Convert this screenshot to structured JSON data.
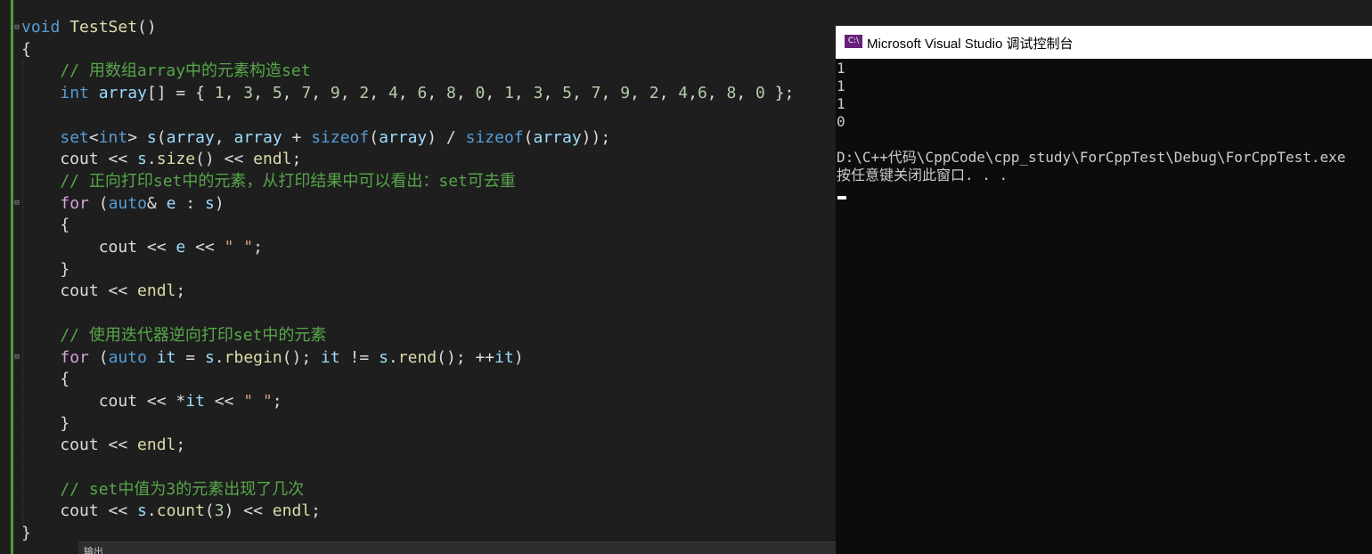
{
  "editor": {
    "lines": [
      [
        {
          "t": "void ",
          "c": "kw"
        },
        {
          "t": "TestSet",
          "c": "fn"
        },
        {
          "t": "()",
          "c": "pl"
        }
      ],
      [
        {
          "t": "{",
          "c": "pl"
        }
      ],
      [
        {
          "t": "    // 用数组array中的元素构造set",
          "c": "cm"
        }
      ],
      [
        {
          "t": "    ",
          "c": "pl"
        },
        {
          "t": "int ",
          "c": "kw"
        },
        {
          "t": "array",
          "c": "vr"
        },
        {
          "t": "[] = { ",
          "c": "pl"
        },
        {
          "t": "1",
          "c": "nm"
        },
        {
          "t": ", ",
          "c": "pl"
        },
        {
          "t": "3",
          "c": "nm"
        },
        {
          "t": ", ",
          "c": "pl"
        },
        {
          "t": "5",
          "c": "nm"
        },
        {
          "t": ", ",
          "c": "pl"
        },
        {
          "t": "7",
          "c": "nm"
        },
        {
          "t": ", ",
          "c": "pl"
        },
        {
          "t": "9",
          "c": "nm"
        },
        {
          "t": ", ",
          "c": "pl"
        },
        {
          "t": "2",
          "c": "nm"
        },
        {
          "t": ", ",
          "c": "pl"
        },
        {
          "t": "4",
          "c": "nm"
        },
        {
          "t": ", ",
          "c": "pl"
        },
        {
          "t": "6",
          "c": "nm"
        },
        {
          "t": ", ",
          "c": "pl"
        },
        {
          "t": "8",
          "c": "nm"
        },
        {
          "t": ", ",
          "c": "pl"
        },
        {
          "t": "0",
          "c": "nm"
        },
        {
          "t": ", ",
          "c": "pl"
        },
        {
          "t": "1",
          "c": "nm"
        },
        {
          "t": ", ",
          "c": "pl"
        },
        {
          "t": "3",
          "c": "nm"
        },
        {
          "t": ", ",
          "c": "pl"
        },
        {
          "t": "5",
          "c": "nm"
        },
        {
          "t": ", ",
          "c": "pl"
        },
        {
          "t": "7",
          "c": "nm"
        },
        {
          "t": ", ",
          "c": "pl"
        },
        {
          "t": "9",
          "c": "nm"
        },
        {
          "t": ", ",
          "c": "pl"
        },
        {
          "t": "2",
          "c": "nm"
        },
        {
          "t": ", ",
          "c": "pl"
        },
        {
          "t": "4",
          "c": "nm"
        },
        {
          "t": ",",
          "c": "pl"
        },
        {
          "t": "6",
          "c": "nm"
        },
        {
          "t": ", ",
          "c": "pl"
        },
        {
          "t": "8",
          "c": "nm"
        },
        {
          "t": ", ",
          "c": "pl"
        },
        {
          "t": "0",
          "c": "nm"
        },
        {
          "t": " };",
          "c": "pl"
        }
      ],
      [],
      [
        {
          "t": "    ",
          "c": "pl"
        },
        {
          "t": "set",
          "c": "kw"
        },
        {
          "t": "<",
          "c": "pl"
        },
        {
          "t": "int",
          "c": "kw"
        },
        {
          "t": "> ",
          "c": "pl"
        },
        {
          "t": "s",
          "c": "vr"
        },
        {
          "t": "(",
          "c": "pl"
        },
        {
          "t": "array",
          "c": "vr"
        },
        {
          "t": ", ",
          "c": "pl"
        },
        {
          "t": "array",
          "c": "vr"
        },
        {
          "t": " + ",
          "c": "pl"
        },
        {
          "t": "sizeof",
          "c": "kw"
        },
        {
          "t": "(",
          "c": "pl"
        },
        {
          "t": "array",
          "c": "vr"
        },
        {
          "t": ") / ",
          "c": "pl"
        },
        {
          "t": "sizeof",
          "c": "kw"
        },
        {
          "t": "(",
          "c": "pl"
        },
        {
          "t": "array",
          "c": "vr"
        },
        {
          "t": "));",
          "c": "pl"
        }
      ],
      [
        {
          "t": "    cout << ",
          "c": "pl"
        },
        {
          "t": "s",
          "c": "vr"
        },
        {
          "t": ".",
          "c": "pl"
        },
        {
          "t": "size",
          "c": "fn"
        },
        {
          "t": "() << ",
          "c": "pl"
        },
        {
          "t": "endl",
          "c": "fn"
        },
        {
          "t": ";",
          "c": "pl"
        }
      ],
      [
        {
          "t": "    // 正向打印set中的元素，从打印结果中可以看出：set可去重",
          "c": "cm"
        }
      ],
      [
        {
          "t": "    ",
          "c": "pl"
        },
        {
          "t": "for",
          "c": "ctl"
        },
        {
          "t": " (",
          "c": "pl"
        },
        {
          "t": "auto",
          "c": "kw"
        },
        {
          "t": "& ",
          "c": "pl"
        },
        {
          "t": "e",
          "c": "vr"
        },
        {
          "t": " : ",
          "c": "pl"
        },
        {
          "t": "s",
          "c": "vr"
        },
        {
          "t": ")",
          "c": "pl"
        }
      ],
      [
        {
          "t": "    {",
          "c": "pl"
        }
      ],
      [
        {
          "t": "        cout << ",
          "c": "pl"
        },
        {
          "t": "e",
          "c": "vr"
        },
        {
          "t": " << ",
          "c": "pl"
        },
        {
          "t": "\" \"",
          "c": "st"
        },
        {
          "t": ";",
          "c": "pl"
        }
      ],
      [
        {
          "t": "    }",
          "c": "pl"
        }
      ],
      [
        {
          "t": "    cout << ",
          "c": "pl"
        },
        {
          "t": "endl",
          "c": "fn"
        },
        {
          "t": ";",
          "c": "pl"
        }
      ],
      [],
      [
        {
          "t": "    // 使用迭代器逆向打印set中的元素",
          "c": "cm"
        }
      ],
      [
        {
          "t": "    ",
          "c": "pl"
        },
        {
          "t": "for",
          "c": "ctl"
        },
        {
          "t": " (",
          "c": "pl"
        },
        {
          "t": "auto ",
          "c": "kw"
        },
        {
          "t": "it",
          "c": "vr"
        },
        {
          "t": " = ",
          "c": "pl"
        },
        {
          "t": "s",
          "c": "vr"
        },
        {
          "t": ".",
          "c": "pl"
        },
        {
          "t": "rbegin",
          "c": "fn"
        },
        {
          "t": "(); ",
          "c": "pl"
        },
        {
          "t": "it",
          "c": "vr"
        },
        {
          "t": " != ",
          "c": "pl"
        },
        {
          "t": "s",
          "c": "vr"
        },
        {
          "t": ".",
          "c": "pl"
        },
        {
          "t": "rend",
          "c": "fn"
        },
        {
          "t": "(); ++",
          "c": "pl"
        },
        {
          "t": "it",
          "c": "vr"
        },
        {
          "t": ")",
          "c": "pl"
        }
      ],
      [
        {
          "t": "    {",
          "c": "pl"
        }
      ],
      [
        {
          "t": "        cout << *",
          "c": "pl"
        },
        {
          "t": "it",
          "c": "vr"
        },
        {
          "t": " << ",
          "c": "pl"
        },
        {
          "t": "\" \"",
          "c": "st"
        },
        {
          "t": ";",
          "c": "pl"
        }
      ],
      [
        {
          "t": "    }",
          "c": "pl"
        }
      ],
      [
        {
          "t": "    cout << ",
          "c": "pl"
        },
        {
          "t": "endl",
          "c": "fn"
        },
        {
          "t": ";",
          "c": "pl"
        }
      ],
      [],
      [
        {
          "t": "    // set中值为3的元素出现了几次",
          "c": "cm"
        }
      ],
      [
        {
          "t": "    cout << ",
          "c": "pl"
        },
        {
          "t": "s",
          "c": "vr"
        },
        {
          "t": ".",
          "c": "pl"
        },
        {
          "t": "count",
          "c": "fn"
        },
        {
          "t": "(",
          "c": "pl"
        },
        {
          "t": "3",
          "c": "nm"
        },
        {
          "t": ") << ",
          "c": "pl"
        },
        {
          "t": "endl",
          "c": "fn"
        },
        {
          "t": ";",
          "c": "pl"
        }
      ],
      [
        {
          "t": "}",
          "c": "pl"
        }
      ]
    ],
    "output_tab_label": "输出"
  },
  "console": {
    "title": "Microsoft Visual Studio 调试控制台",
    "icon_label": "C:\\",
    "lines": [
      "1",
      "1",
      "1",
      "0",
      "",
      "D:\\C++代码\\CppCode\\cpp_study\\ForCppTest\\Debug\\ForCppTest.exe",
      "按任意键关闭此窗口. . ."
    ]
  },
  "colors": {
    "editor_bg": "#1e1e1e",
    "keyword": "#569cd6",
    "function": "#dcdcaa",
    "comment": "#57a64a",
    "variable": "#9cdcfe",
    "number": "#b5cea8",
    "string": "#d69d85",
    "control": "#d8a0df",
    "console_bg": "#0c0c0c",
    "vs_purple": "#68217a"
  }
}
